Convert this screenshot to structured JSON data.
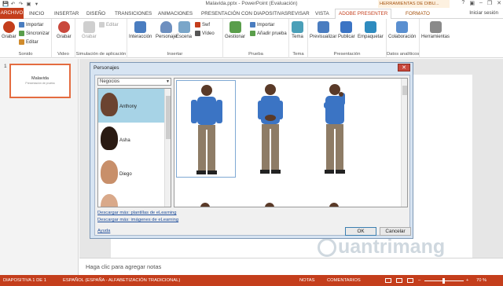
{
  "window": {
    "title": "Malavida.pptx - PowerPoint (Evaluación)",
    "minimize": "–",
    "restore": "❐",
    "close": "✕",
    "help": "?",
    "ribbon_opts": "▣"
  },
  "qat": {
    "save": "💾",
    "undo": "↶",
    "redo": "↷",
    "present": "▣",
    "customize": "▾"
  },
  "tabs": {
    "archivo": "ARCHIVO",
    "inicio": "INICIO",
    "insertar": "INSERTAR",
    "diseno": "DISEÑO",
    "transiciones": "TRANSICIONES",
    "animaciones": "ANIMACIONES",
    "presentacion": "PRESENTACIÓN CON DIAPOSITIVAS",
    "revisar": "REVISAR",
    "vista": "VISTA",
    "adobe": "ADOBE PRESENTER",
    "formato": "FORMATO",
    "context_header": "HERRAMIENTAS DE DIBU...",
    "signin": "Iniciar sesión"
  },
  "ribbon": {
    "sonido": {
      "grabar": "Grabar",
      "importar": "Importar",
      "sincronizar": "Sincronizar",
      "editar": "Editar",
      "label": "Sonido"
    },
    "video": {
      "grabar": "Grabar",
      "label": "Video"
    },
    "simulacion": {
      "grabar": "Grabar",
      "editar": "Editar",
      "label": "Simulación de aplicación"
    },
    "insertar": {
      "interaccion": "Interacción",
      "personaje": "Personaje",
      "escena": "Escena",
      "swf": "Swf",
      "video": "Vídeo",
      "label": "Insertar"
    },
    "prueba": {
      "gestionar": "Gestionar",
      "importar": "Importar",
      "anadir": "Añadir prueba",
      "label": "Prueba"
    },
    "tema": {
      "tema": "Tema",
      "label": "Tema"
    },
    "presentacion": {
      "previsualizar": "Previsualizar",
      "publicar": "Publicar",
      "empaquetar": "Empaquetar",
      "label": "Presentación"
    },
    "datos": {
      "colaboracion": "Colaboración",
      "label": "Datos analíticos"
    },
    "herramientas": {
      "label": "Herramientas"
    }
  },
  "slides": {
    "thumb_number": "1",
    "thumb_title": "Malavida",
    "thumb_subtitle": "Presentación de prueba"
  },
  "notes": {
    "placeholder": "Haga clic para agregar notas"
  },
  "status": {
    "slide": "DIAPOSITIVA 1 DE 1",
    "language": "ESPAÑOL (ESPAÑA - ALFABETIZACIÓN TRADICIONAL)",
    "notas": "NOTAS",
    "comentarios": "COMENTARIOS",
    "zoom_minus": "–",
    "zoom_plus": "+",
    "zoom": "70 %"
  },
  "dialog": {
    "title": "Personajes",
    "close": "✕",
    "category": "Negocios",
    "characters": [
      {
        "name": "Anthony",
        "skin": "#6b4330",
        "bg": "#a7d3e6"
      },
      {
        "name": "Asha",
        "skin": "#4a2c20",
        "bg": "#ffffff"
      },
      {
        "name": "Diego",
        "skin": "#c88f6a",
        "bg": "#ffffff"
      }
    ],
    "link_plantillas": "Descargar más: plantillas de eLearning",
    "link_imagenes": "Descargar más: imágenes de eLearning",
    "help": "Ayuda",
    "ok": "OK",
    "cancel": "Cancelar"
  },
  "colors": {
    "accent": "#c43e1c",
    "shirt": "#3b74c4",
    "pants": "#8e7c66",
    "skin": "#5a3a28",
    "selection": "#a7d3e6"
  },
  "watermark": "uantrimang"
}
